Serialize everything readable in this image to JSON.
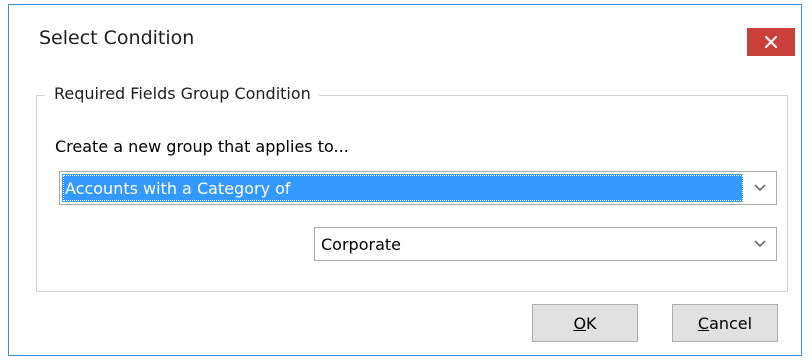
{
  "dialog": {
    "title": "Select Condition",
    "close_icon": "close-icon",
    "accent_color": "#c9403a"
  },
  "group": {
    "legend": "Required Fields Group Condition",
    "prompt": "Create a new group that applies to...",
    "applies_to": {
      "value": "Accounts with a Category of",
      "selected": true,
      "highlight_color": "#3399ff"
    },
    "category": {
      "value": "Corporate"
    }
  },
  "buttons": {
    "ok": {
      "mnemonic": "O",
      "rest": "K"
    },
    "cancel": {
      "mnemonic": "C",
      "rest": "ancel"
    }
  }
}
